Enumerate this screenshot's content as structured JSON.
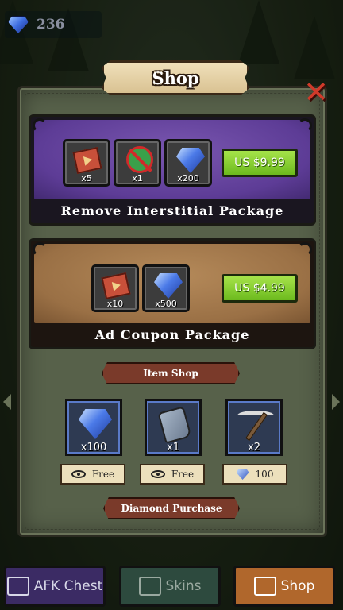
{
  "currency": {
    "icon": "diamond-icon",
    "amount": "236"
  },
  "shop": {
    "title": "Shop",
    "close_icon": "close-x-icon",
    "packages": [
      {
        "title": "Remove Interstitial Package",
        "color": "#5d3c96",
        "items": [
          {
            "icon": "ad-coupon-icon",
            "qty": "x5"
          },
          {
            "icon": "no-ads-icon",
            "qty": "x1"
          },
          {
            "icon": "diamond-icon",
            "qty": "x200"
          }
        ],
        "price": "US $9.99"
      },
      {
        "title": "Ad Coupon Package",
        "color": "#9a7045",
        "items": [
          {
            "icon": "ad-coupon-icon",
            "qty": "x10"
          },
          {
            "icon": "diamond-icon",
            "qty": "x500"
          }
        ],
        "price": "US $4.99"
      }
    ],
    "item_shop": {
      "title": "Item Shop",
      "items": [
        {
          "icon": "diamond-icon",
          "qty": "x100",
          "cost_icon": "video-ad-icon",
          "cost": "Free"
        },
        {
          "icon": "glove-icon",
          "qty": "x1",
          "cost_icon": "video-ad-icon",
          "cost": "Free"
        },
        {
          "icon": "pickaxe-icon",
          "qty": "x2",
          "cost_icon": "diamond-icon",
          "cost": "100"
        }
      ]
    },
    "diamond_purchase": {
      "title": "Diamond Purchase"
    }
  },
  "nav": {
    "afk_chest": "AFK Chest",
    "skins": "Skins",
    "shop": "Shop"
  },
  "colors": {
    "price_button": "#8ed034",
    "section_banner": "#7a3a2a",
    "close_button": "#d03a2a"
  }
}
